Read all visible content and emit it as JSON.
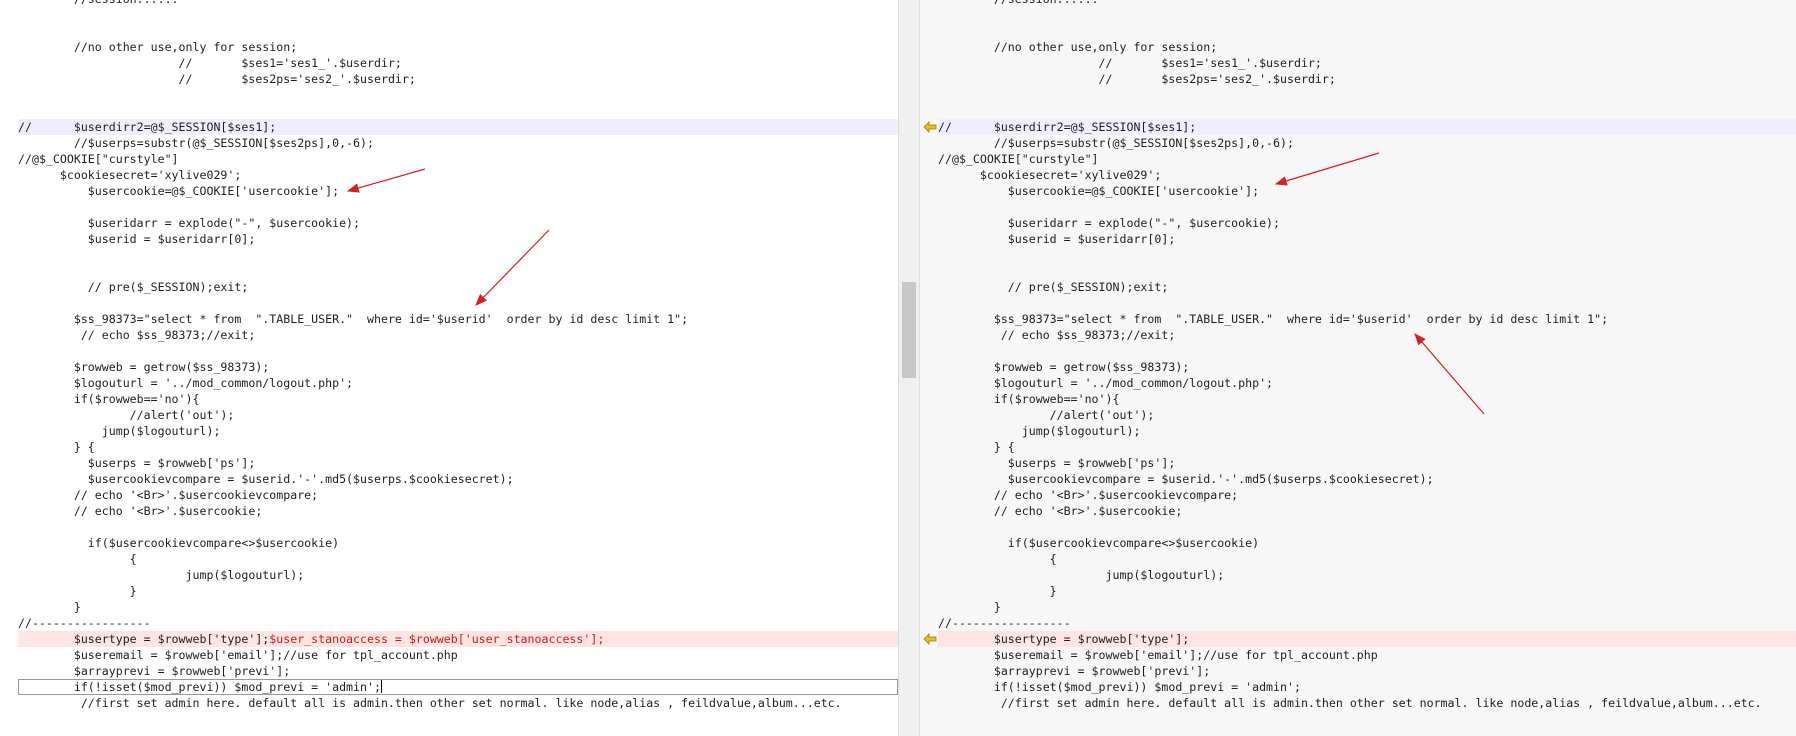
{
  "colors": {
    "modified_line_bg": "#eeeeff",
    "difference_line_bg": "#ffe4e4",
    "difference_text": "#d01818",
    "annotation_arrow": "#d42020",
    "change_marker": "#e8c020"
  },
  "icons": {
    "change_marker": "arrow-left-icon"
  },
  "left_pane": {
    "lines": [
      "        //session......",
      "",
      "",
      "        //no other use,only for session;",
      "                       //       $ses1='ses1_'.$userdir;",
      "                       //       $ses2ps='ses2_'.$userdir;",
      "",
      "",
      "//      $userdirr2=@$_SESSION[$ses1];",
      "        //$userps=substr(@$_SESSION[$ses2ps],0,-6);",
      "//@$_COOKIE[\"curstyle\"]",
      "      $cookiesecret='xylive029';",
      "          $usercookie=@$_COOKIE['usercookie'];",
      "",
      "          $useridarr = explode(\"-\", $usercookie);",
      "          $userid = $useridarr[0];",
      "",
      "",
      "          // pre($_SESSION);exit;",
      "",
      "        $ss_98373=\"select * from  \".TABLE_USER.\"  where id='$userid'  order by id desc limit 1\";",
      "         // echo $ss_98373;//exit;",
      "",
      "        $rowweb = getrow($ss_98373);",
      "        $logouturl = '../mod_common/logout.php';",
      "        if($rowweb=='no'){",
      "                //alert('out');",
      "            jump($logouturl);",
      "        } {",
      "          $userps = $rowweb['ps'];",
      "          $usercookievcompare = $userid.'-'.md5($userps.$cookiesecret);",
      "        // echo '<Br>'.$usercookievcompare;",
      "        // echo '<Br>'.$usercookie;",
      "",
      "          if($usercookievcompare<>$usercookie)",
      "                {",
      "                        jump($logouturl);",
      "                }",
      "        }",
      "//-----------------",
      "        $usertype = $rowweb['type'];",
      "        $useremail = $rowweb['email'];//use for tpl_account.php",
      "        $arrayprevi = $rowweb['previ'];",
      "        if(!isset($mod_previ)) $mod_previ = 'admin';",
      "         //first set admin here. default all is admin.then other set normal. like node,alias , feildvalue,album...etc."
    ],
    "diff_suffix": "$user_stanoaccess = $rowweb['user_stanoaccess'];"
  },
  "right_pane": {
    "lines": [
      "        //session......",
      "",
      "",
      "        //no other use,only for session;",
      "                       //       $ses1='ses1_'.$userdir;",
      "                       //       $ses2ps='ses2_'.$userdir;",
      "",
      "",
      "//      $userdirr2=@$_SESSION[$ses1];",
      "        //$userps=substr(@$_SESSION[$ses2ps],0,-6);",
      "//@$_COOKIE[\"curstyle\"]",
      "      $cookiesecret='xylive029';",
      "          $usercookie=@$_COOKIE['usercookie'];",
      "",
      "          $useridarr = explode(\"-\", $usercookie);",
      "          $userid = $useridarr[0];",
      "",
      "",
      "          // pre($_SESSION);exit;",
      "",
      "        $ss_98373=\"select * from  \".TABLE_USER.\"  where id='$userid'  order by id desc limit 1\";",
      "         // echo $ss_98373;//exit;",
      "",
      "        $rowweb = getrow($ss_98373);",
      "        $logouturl = '../mod_common/logout.php';",
      "        if($rowweb=='no'){",
      "                //alert('out');",
      "            jump($logouturl);",
      "        } {",
      "          $userps = $rowweb['ps'];",
      "          $usercookievcompare = $userid.'-'.md5($userps.$cookiesecret);",
      "        // echo '<Br>'.$usercookievcompare;",
      "        // echo '<Br>'.$usercookie;",
      "",
      "          if($usercookievcompare<>$usercookie)",
      "                {",
      "                        jump($logouturl);",
      "                }",
      "        }",
      "//-----------------",
      "        $usertype = $rowweb['type'];",
      "        $useremail = $rowweb['email'];//use for tpl_account.php",
      "        $arrayprevi = $rowweb['previ'];",
      "        if(!isset($mod_previ)) $mod_previ = 'admin';",
      "         //first set admin here. default all is admin.then other set normal. like node,alias , feildvalue,album...etc."
    ]
  },
  "line_flags": {
    "modified_line_index": 8,
    "difference_line_index": 40,
    "cursor_line_index": 43
  }
}
